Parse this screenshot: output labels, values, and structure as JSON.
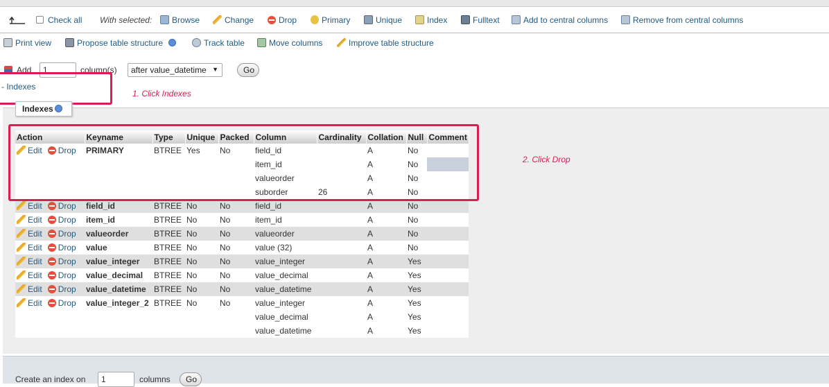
{
  "toolbar_with": {
    "check_all": "Check all",
    "with_selected": "With selected:",
    "actions": [
      "Browse",
      "Change",
      "Drop",
      "Primary",
      "Unique",
      "Index",
      "Fulltext",
      "Add to central columns",
      "Remove from central columns"
    ]
  },
  "toolbar_tools": {
    "items": [
      "Print view",
      "Propose table structure",
      "Track table",
      "Move columns",
      "Improve table structure"
    ]
  },
  "add_columns": {
    "label": "Add",
    "count": "1",
    "unit": "column(s)",
    "position": "after value_datetime",
    "go": "Go"
  },
  "indexes_toggle": "- Indexes",
  "indexes_legend": "Indexes",
  "annotations": {
    "step1": "1. Click Indexes",
    "step2": "2. Click Drop"
  },
  "table": {
    "headers": [
      "Action",
      "Keyname",
      "Type",
      "Unique",
      "Packed",
      "Column",
      "Cardinality",
      "Collation",
      "Null",
      "Comment"
    ],
    "edit_label": "Edit",
    "drop_label": "Drop",
    "indexes": [
      {
        "keyname": "PRIMARY",
        "type": "BTREE",
        "unique": "Yes",
        "packed": "No",
        "columns": [
          {
            "column": "field_id",
            "cardinality": "",
            "collation": "A",
            "null": "No"
          },
          {
            "column": "item_id",
            "cardinality": "",
            "collation": "A",
            "null": "No"
          },
          {
            "column": "valueorder",
            "cardinality": "",
            "collation": "A",
            "null": "No"
          },
          {
            "column": "suborder",
            "cardinality": "26",
            "collation": "A",
            "null": "No"
          }
        ]
      },
      {
        "keyname": "field_id",
        "type": "BTREE",
        "unique": "No",
        "packed": "No",
        "columns": [
          {
            "column": "field_id",
            "cardinality": "",
            "collation": "A",
            "null": "No"
          }
        ]
      },
      {
        "keyname": "item_id",
        "type": "BTREE",
        "unique": "No",
        "packed": "No",
        "columns": [
          {
            "column": "item_id",
            "cardinality": "",
            "collation": "A",
            "null": "No"
          }
        ]
      },
      {
        "keyname": "valueorder",
        "type": "BTREE",
        "unique": "No",
        "packed": "No",
        "columns": [
          {
            "column": "valueorder",
            "cardinality": "",
            "collation": "A",
            "null": "No"
          }
        ]
      },
      {
        "keyname": "value",
        "type": "BTREE",
        "unique": "No",
        "packed": "No",
        "columns": [
          {
            "column": "value (32)",
            "cardinality": "",
            "collation": "A",
            "null": "No"
          }
        ]
      },
      {
        "keyname": "value_integer",
        "type": "BTREE",
        "unique": "No",
        "packed": "No",
        "columns": [
          {
            "column": "value_integer",
            "cardinality": "",
            "collation": "A",
            "null": "Yes"
          }
        ]
      },
      {
        "keyname": "value_decimal",
        "type": "BTREE",
        "unique": "No",
        "packed": "No",
        "columns": [
          {
            "column": "value_decimal",
            "cardinality": "",
            "collation": "A",
            "null": "Yes"
          }
        ]
      },
      {
        "keyname": "value_datetime",
        "type": "BTREE",
        "unique": "No",
        "packed": "No",
        "columns": [
          {
            "column": "value_datetime",
            "cardinality": "",
            "collation": "A",
            "null": "Yes"
          }
        ]
      },
      {
        "keyname": "value_integer_2",
        "type": "BTREE",
        "unique": "No",
        "packed": "No",
        "columns": [
          {
            "column": "value_integer",
            "cardinality": "",
            "collation": "A",
            "null": "Yes"
          },
          {
            "column": "value_decimal",
            "cardinality": "",
            "collation": "A",
            "null": "Yes"
          },
          {
            "column": "value_datetime",
            "cardinality": "",
            "collation": "A",
            "null": "Yes"
          }
        ]
      }
    ]
  },
  "create_index": {
    "label": "Create an index on",
    "count": "1",
    "unit": "columns",
    "go": "Go"
  },
  "colors": {
    "annotation": "#d81e53",
    "link": "#235a81",
    "row_alt": "#dfdfdf"
  }
}
